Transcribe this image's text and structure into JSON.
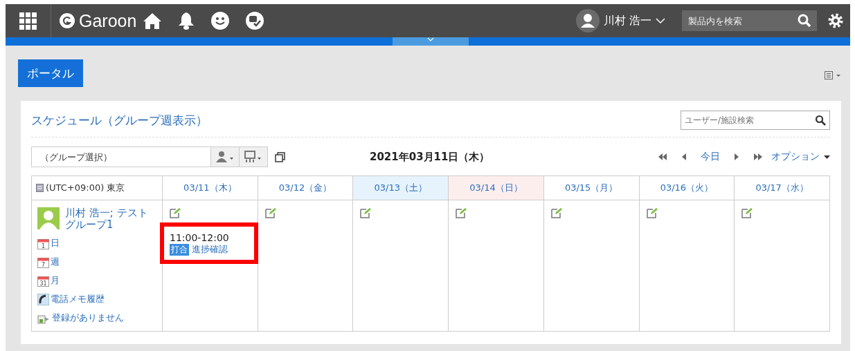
{
  "header": {
    "logo": "Garoon",
    "user": "川村 浩一",
    "search": {
      "placeholder": "製品内を検索"
    }
  },
  "portal": {
    "title": "ポータル"
  },
  "schedule": {
    "title": "スケジュール（グループ週表示）",
    "search": {
      "placeholder": "ユーザー/施設検索"
    },
    "group_select": "（グループ選択）",
    "date": "2021年03月11日（木）",
    "today": "今日",
    "options": "オプション",
    "timezone": "(UTC+09:00) 東京",
    "days": [
      {
        "label": "03/11（木）",
        "kind": "weekday",
        "events": [
          {
            "time": "11:00-12:00",
            "tag": "打合",
            "title": "進捗確認",
            "highlighted": true
          }
        ]
      },
      {
        "label": "03/12（金）",
        "kind": "weekday"
      },
      {
        "label": "03/13（土）",
        "kind": "saturday"
      },
      {
        "label": "03/14（日）",
        "kind": "sunday"
      },
      {
        "label": "03/15（月）",
        "kind": "weekday"
      },
      {
        "label": "03/16（火）",
        "kind": "weekday"
      },
      {
        "label": "03/17（水）",
        "kind": "weekday"
      }
    ],
    "member": {
      "name": "川村 浩一; テストグループ1",
      "links": [
        {
          "label": "日",
          "kind": "day",
          "num": "1"
        },
        {
          "label": "週",
          "kind": "week",
          "num": "7"
        },
        {
          "label": "月",
          "kind": "month",
          "num": "31"
        },
        {
          "label": "電話メモ履歴",
          "kind": "phone"
        },
        {
          "label": "登録がありません",
          "kind": "presence"
        }
      ]
    }
  }
}
